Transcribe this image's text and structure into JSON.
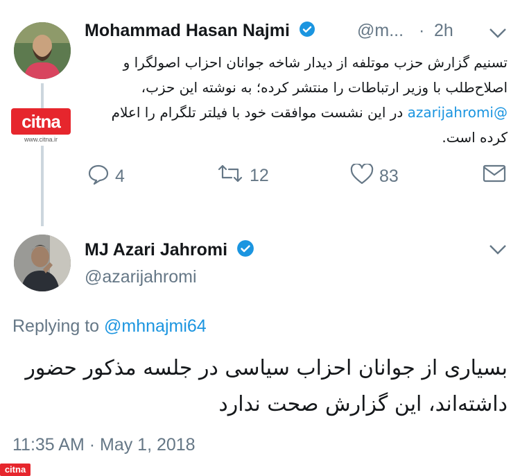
{
  "tweet1": {
    "author_name": "Mohammad Hasan Najmi",
    "author_handle": "@m...",
    "separator": "·",
    "time": "2h",
    "text_part1": "تسنیم گزارش حزب موتلفه از دیدار شاخه جوانان احزاب اصولگرا و اصلاح‌طلب با وزیر ارتباطات را منتشر کرده؛ به نوشته این حزب، ",
    "text_mention": "@azarijahromi",
    "text_part2": " در این نشست موافقت خود با فیلتر تلگرام را اعلام کرده است.",
    "reply_count": "4",
    "retweet_count": "12",
    "like_count": "83"
  },
  "badge": {
    "logo_text": "citna",
    "url": "www.citna.ir"
  },
  "tweet2": {
    "author_name": "MJ Azari Jahromi",
    "author_handle": "@azarijahromi",
    "replying_prefix": "Replying to",
    "replying_handle": "@mhnajmi64",
    "text": "بسیاری از جوانان احزاب سیاسی در جلسه مذکور حضور داشته‌اند، این گزارش صحت ندارد",
    "timestamp": "11:35 AM · May 1, 2018"
  },
  "watermark": {
    "text": "citna"
  },
  "colors": {
    "accent": "#1b95e0",
    "muted": "#657786",
    "brand_red": "#e6262d",
    "thread_line": "#ccd6dd"
  }
}
